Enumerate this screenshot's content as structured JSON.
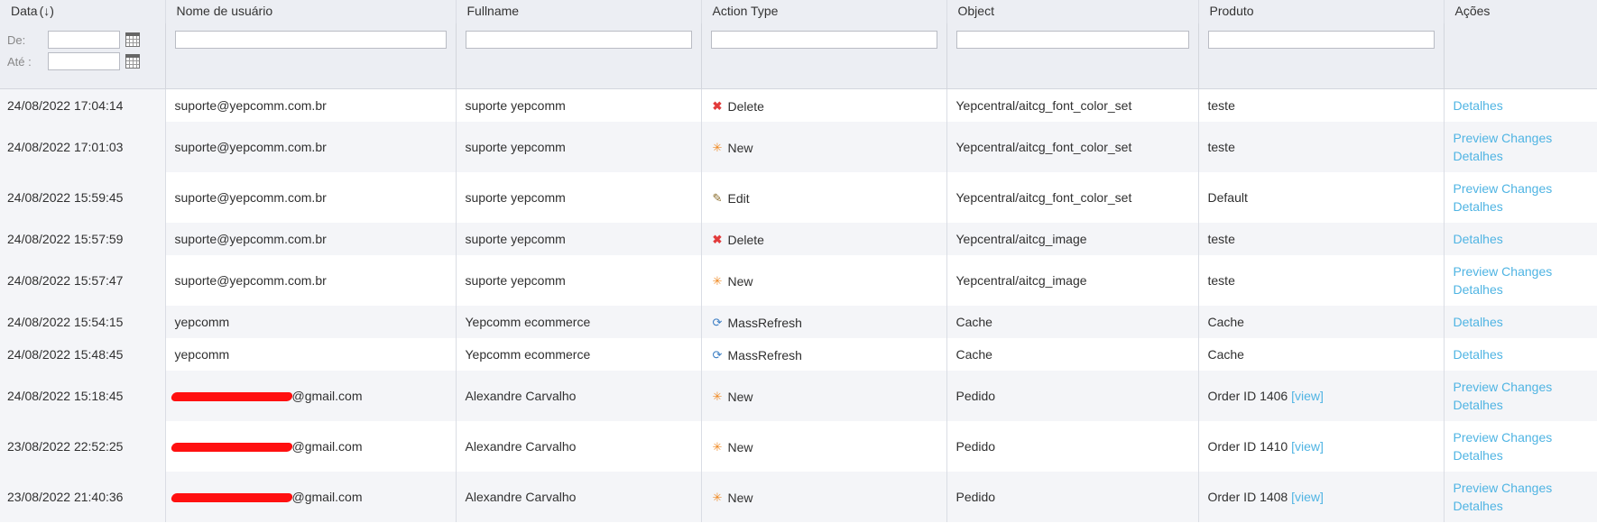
{
  "columns": {
    "data": "Data",
    "data_sort": "(↓)",
    "username": "Nome de usuário",
    "fullname": "Fullname",
    "action_type": "Action Type",
    "object": "Object",
    "produto": "Produto",
    "acoes": "Ações"
  },
  "filters": {
    "de_label": "De:",
    "ate_label": "Até :"
  },
  "rows": [
    {
      "date": "24/08/2022 17:04:14",
      "user": "suporte@yepcomm.com.br",
      "fullname": "suporte yepcomm",
      "action": "Delete",
      "action_icon": "delete-icon",
      "object": "Yepcentral/aitcg_font_color_set",
      "produto": "teste",
      "preview": "",
      "detalhes": "Detalhes"
    },
    {
      "date": "24/08/2022 17:01:03",
      "user": "suporte@yepcomm.com.br",
      "fullname": "suporte yepcomm",
      "action": "New",
      "action_icon": "new-icon",
      "object": "Yepcentral/aitcg_font_color_set",
      "produto": "teste",
      "preview": "Preview Changes",
      "detalhes": "Detalhes"
    },
    {
      "date": "24/08/2022 15:59:45",
      "user": "suporte@yepcomm.com.br",
      "fullname": "suporte yepcomm",
      "action": "Edit",
      "action_icon": "edit-icon",
      "object": "Yepcentral/aitcg_font_color_set",
      "produto": "Default",
      "preview": "Preview Changes",
      "detalhes": "Detalhes"
    },
    {
      "date": "24/08/2022 15:57:59",
      "user": "suporte@yepcomm.com.br",
      "fullname": "suporte yepcomm",
      "action": "Delete",
      "action_icon": "delete-icon",
      "object": "Yepcentral/aitcg_image",
      "produto": "teste",
      "preview": "",
      "detalhes": "Detalhes"
    },
    {
      "date": "24/08/2022 15:57:47",
      "user": "suporte@yepcomm.com.br",
      "fullname": "suporte yepcomm",
      "action": "New",
      "action_icon": "new-icon",
      "object": "Yepcentral/aitcg_image",
      "produto": "teste",
      "preview": "Preview Changes",
      "detalhes": "Detalhes"
    },
    {
      "date": "24/08/2022 15:54:15",
      "user": "yepcomm",
      "fullname": "Yepcomm ecommerce",
      "action": "MassRefresh",
      "action_icon": "refresh-icon",
      "object": "Cache",
      "produto": "Cache",
      "preview": "",
      "detalhes": "Detalhes"
    },
    {
      "date": "24/08/2022 15:48:45",
      "user": "yepcomm",
      "fullname": "Yepcomm ecommerce",
      "action": "MassRefresh",
      "action_icon": "refresh-icon",
      "object": "Cache",
      "produto": "Cache",
      "preview": "",
      "detalhes": "Detalhes"
    },
    {
      "date": "24/08/2022 15:18:45",
      "user": "@gmail.com",
      "redacted": true,
      "fullname": "Alexandre Carvalho",
      "action": "New",
      "action_icon": "new-icon",
      "object": "Pedido",
      "produto": "Order ID 1406",
      "view": "[view]",
      "preview": "Preview Changes",
      "detalhes": "Detalhes"
    },
    {
      "date": "23/08/2022 22:52:25",
      "user": "@gmail.com",
      "redacted": true,
      "fullname": "Alexandre Carvalho",
      "action": "New",
      "action_icon": "new-icon",
      "object": "Pedido",
      "produto": "Order ID 1410",
      "view": "[view]",
      "preview": "Preview Changes",
      "detalhes": "Detalhes"
    },
    {
      "date": "23/08/2022 21:40:36",
      "user": "@gmail.com",
      "redacted": true,
      "fullname": "Alexandre Carvalho",
      "action": "New",
      "action_icon": "new-icon",
      "object": "Pedido",
      "produto": "Order ID 1408",
      "view": "[view]",
      "preview": "Preview Changes",
      "detalhes": "Detalhes"
    }
  ],
  "colors": {
    "link": "#4fb4e3",
    "header_bg": "#eceef3",
    "redaction": "#ff1010"
  }
}
